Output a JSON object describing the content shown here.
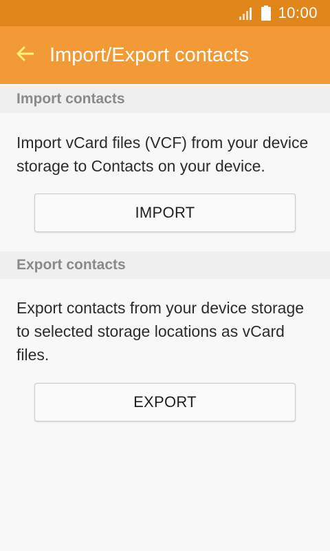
{
  "status_bar": {
    "time": "10:00",
    "signal_icon": "signal-icon",
    "battery_icon": "battery-icon"
  },
  "app_bar": {
    "title": "Import/Export contacts",
    "back_icon": "back-arrow-icon"
  },
  "import_section": {
    "header": "Import contacts",
    "description": "Import vCard files (VCF) from your device storage to Contacts on your device.",
    "button_label": "IMPORT"
  },
  "export_section": {
    "header": "Export contacts",
    "description": "Export contacts from your device storage to selected storage locations as vCard files.",
    "button_label": "EXPORT"
  },
  "colors": {
    "status_bar": "#e0861a",
    "app_bar": "#f29a35",
    "back_arrow": "#fff176",
    "section_header_bg": "#efefef",
    "page_bg": "#f8f8f8"
  }
}
